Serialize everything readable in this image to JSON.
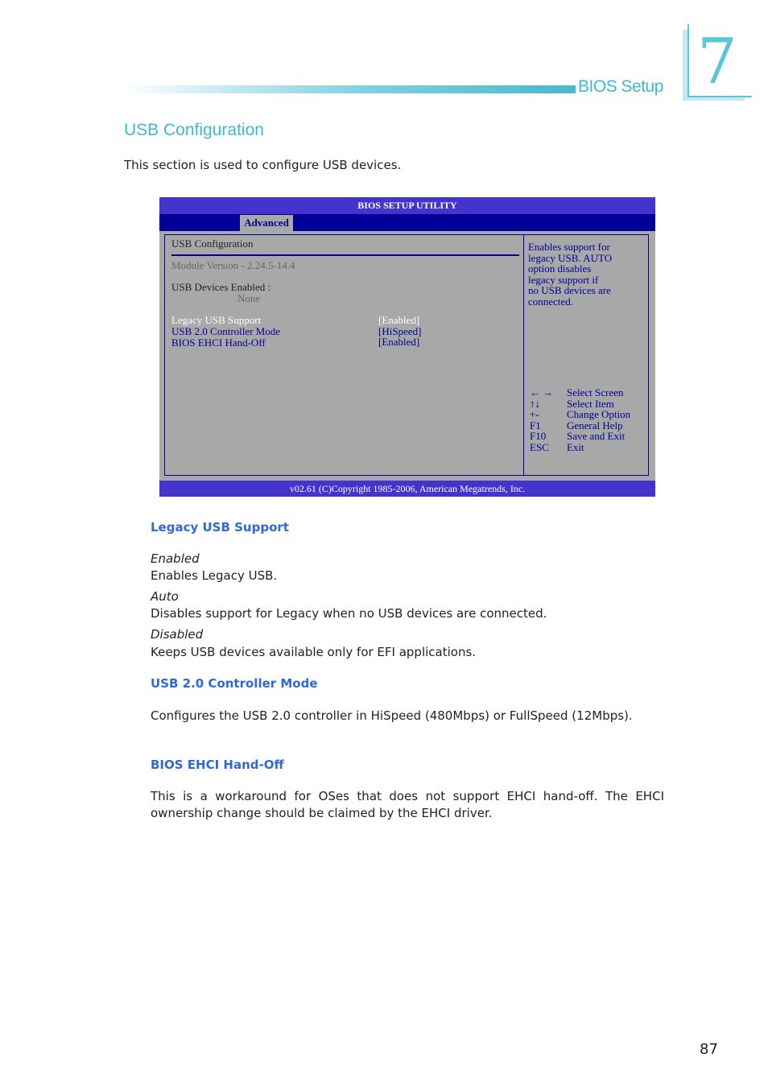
{
  "header": {
    "section_label": "BIOS Setup",
    "chapter_number": "7"
  },
  "section": {
    "title": "USB Configuration",
    "intro": "This section is used to configure USB devices."
  },
  "bios": {
    "title": "BIOS SETUP UTILITY",
    "active_tab": "Advanced",
    "screen_title": "USB Configuration",
    "module_version": "Module Version - 2.24.5-14.4",
    "devices_label": "USB Devices Enabled :",
    "devices_value": "None",
    "settings": [
      {
        "label": "Legacy USB Support",
        "value": "[Enabled]",
        "selected": true
      },
      {
        "label": "USB 2.0 Controller Mode",
        "value": "[HiSpeed]",
        "selected": false
      },
      {
        "label": "BIOS EHCI Hand-Off",
        "value": "[Enabled]",
        "selected": false
      }
    ],
    "help_lines": [
      "Enables support for",
      "legacy USB. AUTO",
      "option disables",
      "legacy support if",
      "no USB devices are",
      "connected."
    ],
    "keys": [
      {
        "key": "← →",
        "action": "Select Screen"
      },
      {
        "key": "↑↓",
        "action": "Select Item"
      },
      {
        "key": "+-",
        "action": "Change Option"
      },
      {
        "key": "F1",
        "action": "General Help"
      },
      {
        "key": "F10",
        "action": "Save and Exit"
      },
      {
        "key": "ESC",
        "action": "Exit"
      }
    ],
    "footer": "v02.61 (C)Copyright 1985-2006, American Megatrends, Inc."
  },
  "descriptions": {
    "legacy": {
      "heading": "Legacy USB Support",
      "options": [
        {
          "name": "Enabled",
          "text": "Enables Legacy USB."
        },
        {
          "name": "Auto",
          "text": "Disables support for Legacy when no USB devices are connected."
        },
        {
          "name": "Disabled",
          "text": "Keeps USB devices available only for EFI applications."
        }
      ]
    },
    "controller": {
      "heading": "USB 2.0 Controller Mode",
      "text": "Configures the USB 2.0 controller in HiSpeed (480Mbps) or FullSpeed (12Mbps)."
    },
    "ehci": {
      "heading": "BIOS EHCI Hand-Off",
      "text": "This is a workaround for OSes that does not support EHCI hand-off. The EHCI ownership change should be claimed by the EHCI driver."
    }
  },
  "page_number": "87"
}
